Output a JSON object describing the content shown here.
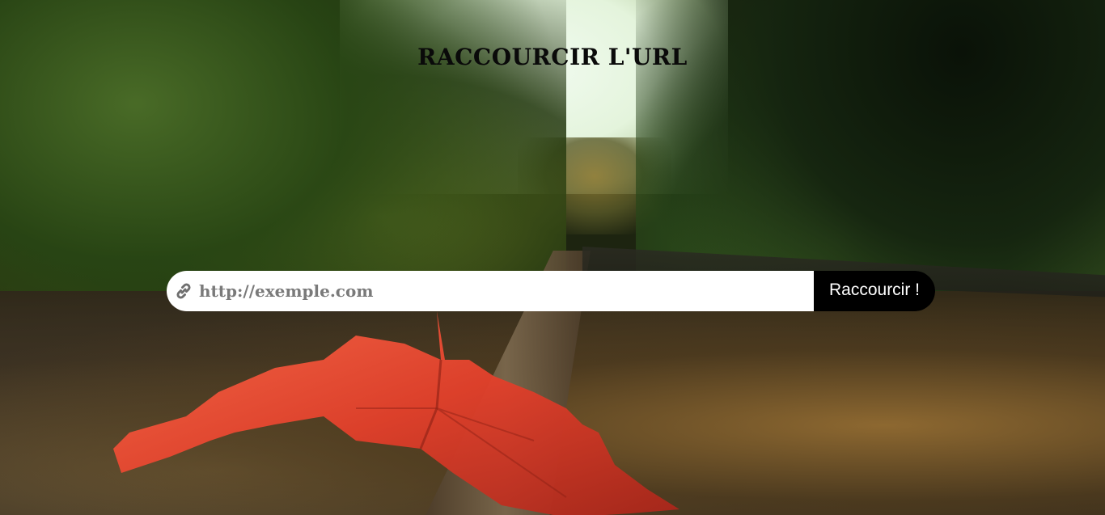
{
  "header": {
    "title": "RACCOURCIR L'URL"
  },
  "form": {
    "input_placeholder": "http://exemple.com",
    "input_value": "",
    "input_icon": "link-icon",
    "submit_label": "Raccourcir !"
  },
  "colors": {
    "button_background": "#000000",
    "input_background": "#ffffff",
    "placeholder_text": "#7a7a7a",
    "leaf_red": "#e84a32"
  }
}
